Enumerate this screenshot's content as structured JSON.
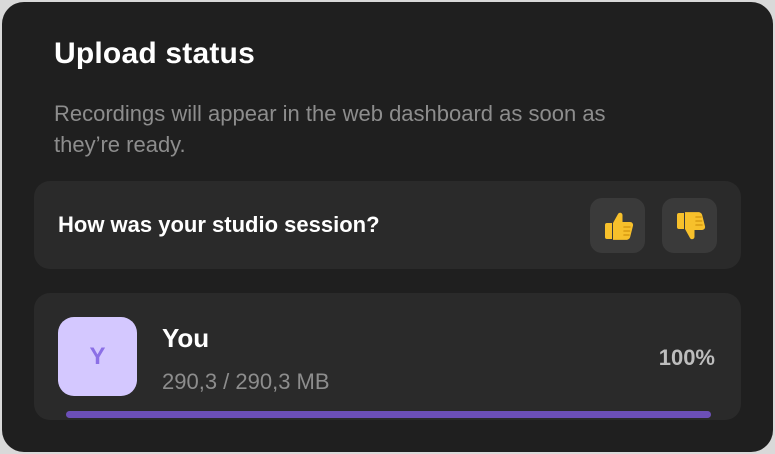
{
  "header": {
    "title": "Upload status",
    "subtitle": "Recordings will appear in the web dashboard as soon as they’re ready."
  },
  "feedback": {
    "question": "How was your studio session?",
    "thumbs_up_icon": "thumbs-up-emoji",
    "thumbs_down_icon": "thumbs-down-emoji"
  },
  "upload": {
    "avatar_initial": "Y",
    "name": "You",
    "size_text": "290,3 / 290,3 MB",
    "percent_text": "100%",
    "progress_fraction": 1.0
  },
  "colors": {
    "panel_bg": "#1f1f1f",
    "card_bg": "#2a2a2a",
    "avatar_bg": "#d4c8ff",
    "avatar_text": "#8b6fe6",
    "progress": "#6c4fb8",
    "emoji_yellow": "#f7c02b"
  }
}
